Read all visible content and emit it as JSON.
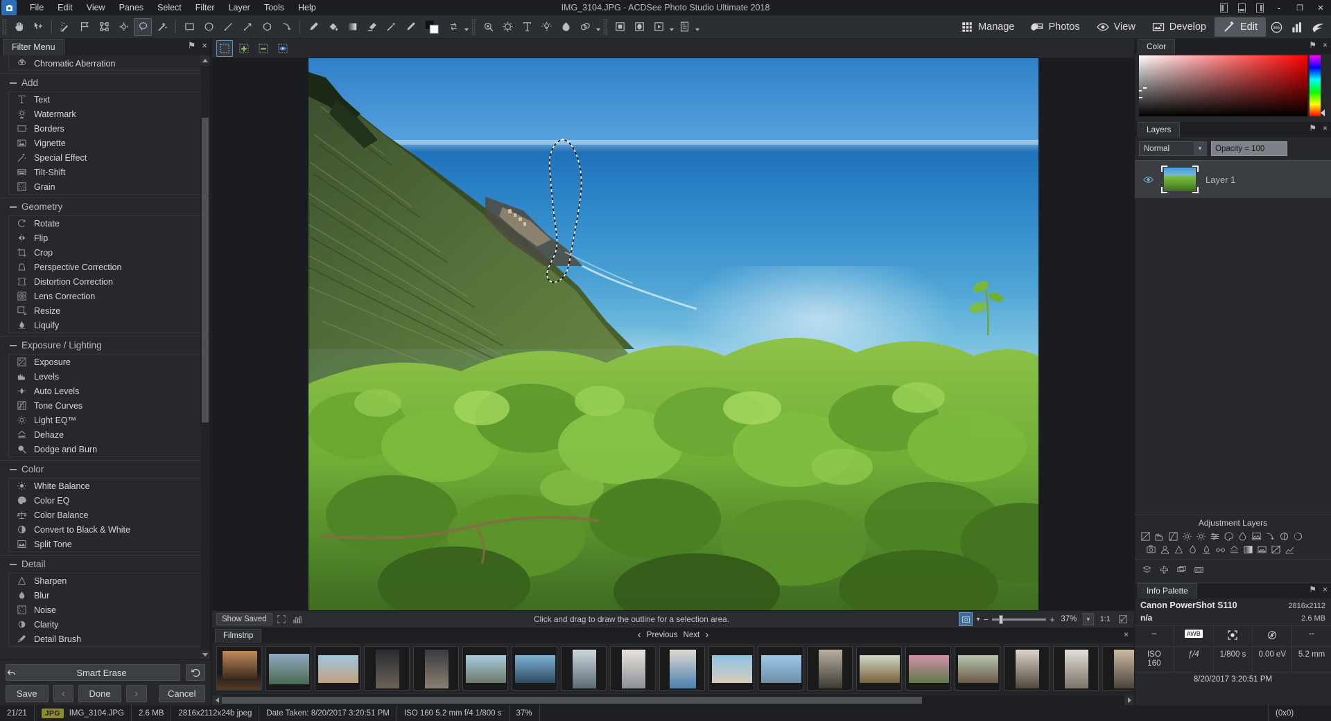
{
  "titlebar": {
    "app_icon": "camera-icon",
    "title": "IMG_3104.JPG - ACDSee Photo Studio Ultimate 2018",
    "menus": [
      "File",
      "Edit",
      "View",
      "Panes",
      "Select",
      "Filter",
      "Layer",
      "Tools",
      "Help"
    ],
    "window_buttons": [
      "minimize",
      "restore",
      "close"
    ],
    "minimize_glyph": "-",
    "restore_glyph": "❐",
    "close_glyph": "×"
  },
  "toolbar": {
    "groups": [
      {
        "tools": [
          "hand-pan-icon",
          "move-select-icon"
        ]
      },
      {
        "tools": [
          "magic-wand-icon",
          "polygon-lasso-icon",
          "marquee-dots-icon",
          "transform-icon",
          "freehand-lasso-icon",
          "smart-select-icon"
        ]
      },
      {
        "tools": [
          "rectangle-icon",
          "ellipse-icon",
          "line-icon",
          "arrow-icon",
          "polygon-icon",
          "curve-icon"
        ]
      },
      {
        "tools": [
          "pen-icon",
          "fill-bucket-icon",
          "gradient-icon",
          "eraser-icon",
          "smart-erase-icon",
          "clone-stamp-icon"
        ]
      },
      {
        "tools": [
          "color-swatch-icon",
          "swap-colors-icon"
        ]
      },
      {
        "tools": [
          "red-eye-icon",
          "blemish-remover-icon",
          "text-tool-icon",
          "light-eq-icon",
          "dodge-burn-icon",
          "blur-tool-icon"
        ]
      },
      {
        "tools": [
          "layer-mask-icon",
          "layer-ellipse-icon",
          "slideshow-icon",
          "batch-icon"
        ]
      }
    ]
  },
  "nav": {
    "tabs": [
      {
        "label": "Manage",
        "icon": "grid-icon",
        "active": false
      },
      {
        "label": "Photos",
        "icon": "photos-icon",
        "active": false
      },
      {
        "label": "View",
        "icon": "eye-icon",
        "active": false
      },
      {
        "label": "Develop",
        "icon": "develop-icon",
        "active": false
      },
      {
        "label": "Edit",
        "icon": "edit-icon",
        "active": true
      }
    ],
    "extra_icons": [
      "365-icon",
      "chart-icon",
      "acdsee-logo-icon"
    ]
  },
  "selection_toolbar": {
    "buttons": [
      "new-selection-icon",
      "add-to-selection-icon",
      "subtract-from-selection-icon",
      "invert-selection-icon"
    ],
    "active_index": 0
  },
  "left_panel": {
    "tab_label": "Filter Menu",
    "pin_glyph": "⚑",
    "close_glyph": "×",
    "top_partial_item": {
      "label": "Chromatic Aberration",
      "icon": "chromatic-aberration-icon"
    },
    "groups": [
      {
        "title": "Add",
        "items": [
          {
            "label": "Text",
            "icon": "text-icon"
          },
          {
            "label": "Watermark",
            "icon": "watermark-icon"
          },
          {
            "label": "Borders",
            "icon": "borders-icon"
          },
          {
            "label": "Vignette",
            "icon": "vignette-icon"
          },
          {
            "label": "Special Effect",
            "icon": "special-effect-icon"
          },
          {
            "label": "Tilt-Shift",
            "icon": "tilt-shift-icon"
          },
          {
            "label": "Grain",
            "icon": "grain-icon"
          }
        ]
      },
      {
        "title": "Geometry",
        "items": [
          {
            "label": "Rotate",
            "icon": "rotate-icon"
          },
          {
            "label": "Flip",
            "icon": "flip-icon"
          },
          {
            "label": "Crop",
            "icon": "crop-icon"
          },
          {
            "label": "Perspective Correction",
            "icon": "perspective-correction-icon"
          },
          {
            "label": "Distortion Correction",
            "icon": "distortion-correction-icon"
          },
          {
            "label": "Lens Correction",
            "icon": "lens-correction-icon"
          },
          {
            "label": "Resize",
            "icon": "resize-icon"
          },
          {
            "label": "Liquify",
            "icon": "liquify-icon"
          }
        ]
      },
      {
        "title": "Exposure / Lighting",
        "items": [
          {
            "label": "Exposure",
            "icon": "exposure-icon"
          },
          {
            "label": "Levels",
            "icon": "levels-icon"
          },
          {
            "label": "Auto Levels",
            "icon": "auto-levels-icon"
          },
          {
            "label": "Tone Curves",
            "icon": "tone-curves-icon"
          },
          {
            "label": "Light EQ™",
            "icon": "light-eq-icon"
          },
          {
            "label": "Dehaze",
            "icon": "dehaze-icon"
          },
          {
            "label": "Dodge and Burn",
            "icon": "dodge-and-burn-icon"
          }
        ]
      },
      {
        "title": "Color",
        "items": [
          {
            "label": "White Balance",
            "icon": "white-balance-icon"
          },
          {
            "label": "Color EQ",
            "icon": "color-eq-icon"
          },
          {
            "label": "Color Balance",
            "icon": "color-balance-icon"
          },
          {
            "label": "Convert to Black & White",
            "icon": "convert-bw-icon"
          },
          {
            "label": "Split Tone",
            "icon": "split-tone-icon"
          }
        ]
      },
      {
        "title": "Detail",
        "items": [
          {
            "label": "Sharpen",
            "icon": "sharpen-icon"
          },
          {
            "label": "Blur",
            "icon": "blur-icon"
          },
          {
            "label": "Noise",
            "icon": "noise-icon"
          },
          {
            "label": "Clarity",
            "icon": "clarity-icon"
          },
          {
            "label": "Detail Brush",
            "icon": "detail-brush-icon"
          }
        ]
      }
    ],
    "smart_erase_label": "Smart Erase",
    "undo_icon": "undo-arrow-icon",
    "reset_icon": "reset-icon",
    "buttons": {
      "save": "Save",
      "prev_glyph": "‹",
      "done": "Done",
      "next_glyph": "›",
      "cancel": "Cancel"
    }
  },
  "image_status": {
    "show_saved": "Show Saved",
    "fullscreen_icon": "fullscreen-icon",
    "histogram_icon": "histogram-icon",
    "hint": "Click and drag to draw the outline for a selection area.",
    "film_icon": "filmstrip-toggle-icon",
    "dropdown_glyph": "▾",
    "zoom_out_glyph": "−",
    "zoom_in_glyph": "+",
    "zoom_level": "37%",
    "one_to_one": "1:1",
    "fit_icon": "fit-to-window-icon"
  },
  "filmstrip": {
    "tab_label": "Filmstrip",
    "previous": "Previous",
    "next": "Next",
    "prev_glyph": "‹",
    "next_glyph": "›",
    "close_glyph": "×",
    "thumbnail_count": 21,
    "selected_index": 20
  },
  "right_panel": {
    "color": {
      "tab_label": "Color",
      "pin_glyph": "⚑",
      "close_glyph": "×",
      "base_hue_hex": "#ff0000"
    },
    "layers": {
      "tab_label": "Layers",
      "pin_glyph": "⚑",
      "close_glyph": "×",
      "blend_mode": "Normal",
      "blend_dropdown_glyph": "▾",
      "opacity": "Opacity = 100",
      "rows": [
        {
          "name": "Layer 1",
          "visible": true,
          "eye_icon": "eye-icon",
          "selected": true
        }
      ]
    },
    "adjustment_layers": {
      "title": "Adjustment Layers",
      "row1": [
        "exposure-icon",
        "levels-icon",
        "tone-curves-icon",
        "light-eq-icon",
        "white-balance-icon",
        "color-eq-sliders-icon",
        "color-balance-palette-icon",
        "vibrance-icon",
        "split-tone-icon",
        "curve-icon",
        "bw-icon",
        "contrast-icon"
      ],
      "row2": [
        "photo-effect-icon",
        "portrait-icon",
        "sharpen-icon",
        "water-drop-icon",
        "dehaze-icon",
        "glasses-icon",
        "haze-icon",
        "gradient-icon",
        "vignette-icon",
        "soft-focus-icon",
        "levels-graph-icon"
      ],
      "row3": [
        "add-layer-icon",
        "add-plus-icon",
        "duplicate-layer-icon",
        "delete-layer-icon"
      ]
    },
    "info_palette": {
      "tab_label": "Info Palette",
      "pin_glyph": "⚑",
      "close_glyph": "×",
      "camera": "Canon PowerShot S110",
      "dimensions": "2816x2112",
      "lens": "n/a",
      "filesize": "2.6 MB",
      "metering_row": [
        "--",
        "AWB",
        "metering-icon",
        "flash-off-icon",
        "--"
      ],
      "exif_row": [
        "ISO 160",
        "ƒ/4",
        "1/800 s",
        "0.00 eV",
        "5.2 mm"
      ],
      "datetime": "8/20/2017 3:20:51 PM"
    }
  },
  "statusbar": {
    "index": "21/21",
    "format_badge": "JPG",
    "filename": "IMG_3104.JPG",
    "filesize": "2.6 MB",
    "dimensions": "2816x2112x24b jpeg",
    "date_taken": "Date Taken: 8/20/2017 3:20:51 PM",
    "exif": "ISO 160   5.2 mm   f/4   1/800 s",
    "zoom": "37%",
    "coords": "(0x0)"
  }
}
